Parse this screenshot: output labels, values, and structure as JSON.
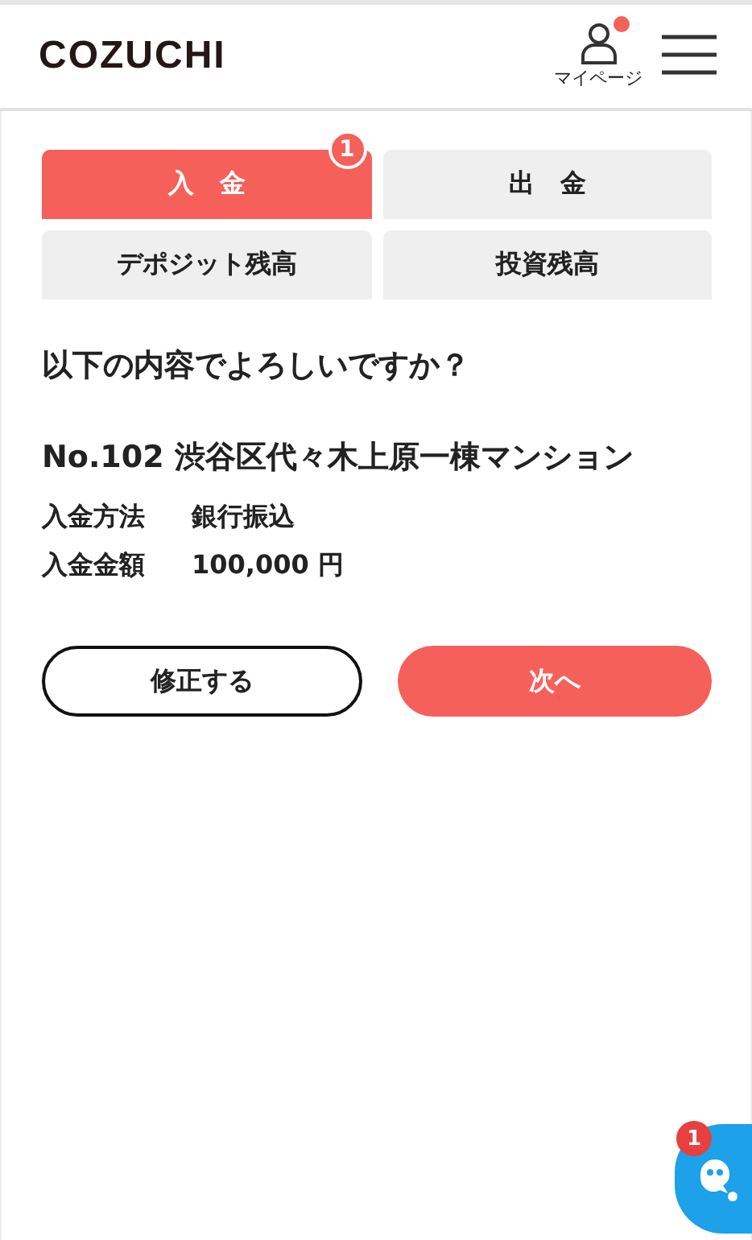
{
  "header": {
    "logo": "COZUCHI",
    "mypage": {
      "label": "マイページ",
      "notification": true
    }
  },
  "tabs": [
    {
      "label": "入　金",
      "selected": true,
      "badge": "1"
    },
    {
      "label": "出　金",
      "selected": false
    },
    {
      "label": "デポジット残高",
      "selected": false
    },
    {
      "label": "投資残高",
      "selected": false
    }
  ],
  "question": "以下の内容でよろしいですか？",
  "project": "No.102 渋谷区代々木上原一棟マンション",
  "details": [
    {
      "label": "入金方法",
      "value": "銀行振込"
    },
    {
      "label": "入金金額",
      "value": "100,000 円"
    }
  ],
  "buttons": [
    {
      "label": "修正する",
      "kind": "secondary"
    },
    {
      "label": "次へ",
      "kind": "primary"
    }
  ],
  "chat_widget": {
    "badge": "1"
  }
}
